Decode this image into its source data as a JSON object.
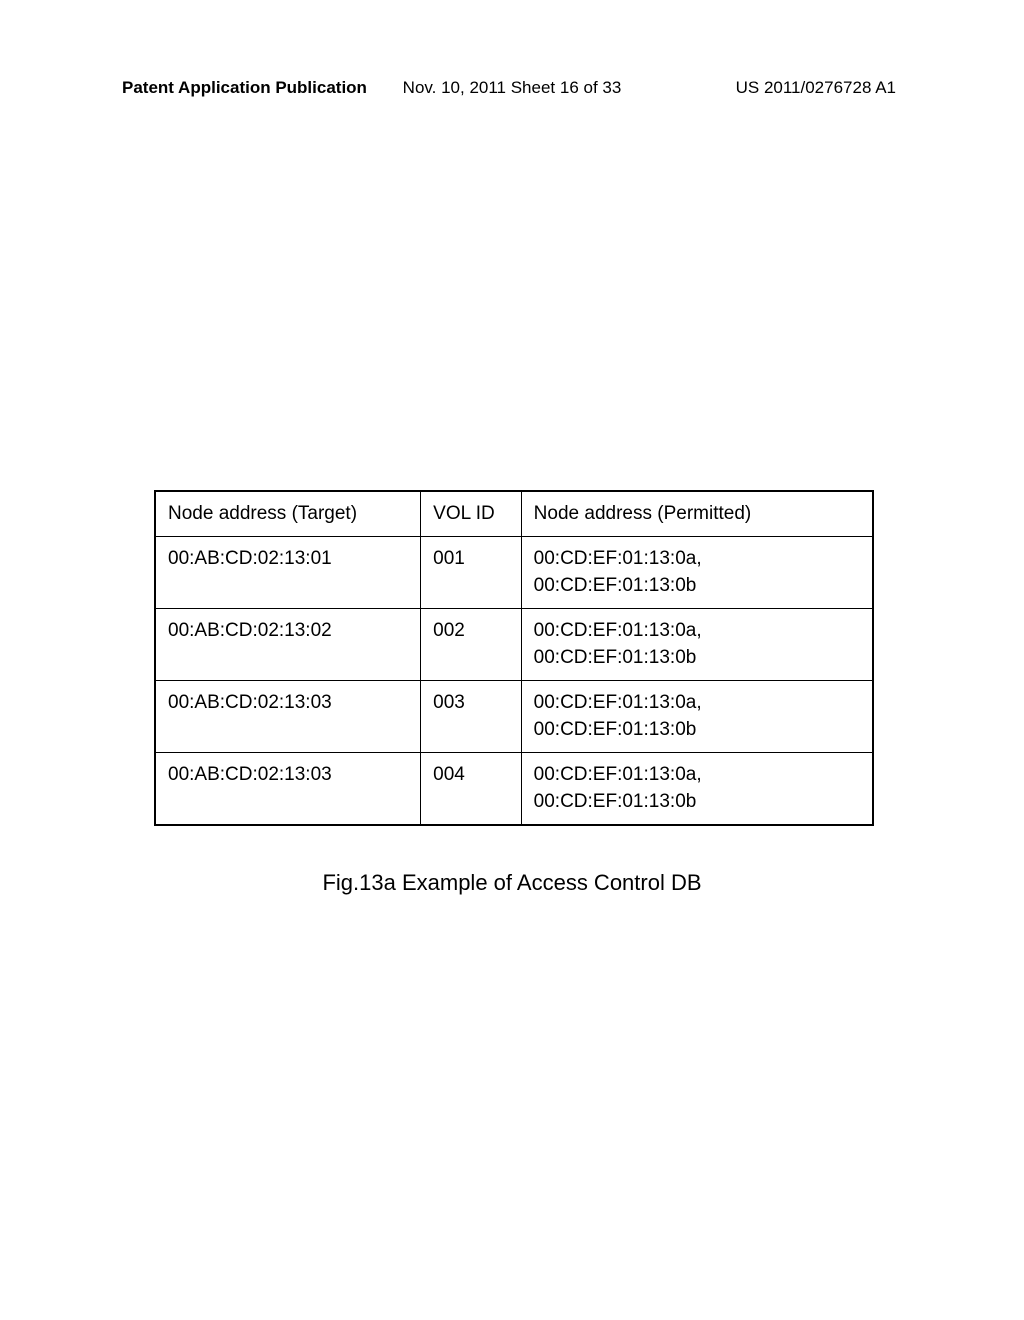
{
  "header": {
    "left": "Patent Application Publication",
    "center": "Nov. 10, 2011  Sheet 16 of 33",
    "right": "US 2011/0276728 A1"
  },
  "table": {
    "headers": {
      "target": "Node address (Target)",
      "vol": "VOL ID",
      "permitted": "Node address (Permitted)"
    },
    "rows": [
      {
        "target": "00:AB:CD:02:13:01",
        "vol": "001",
        "permitted_a": "00:CD:EF:01:13:0a,",
        "permitted_b": "00:CD:EF:01:13:0b"
      },
      {
        "target": "00:AB:CD:02:13:02",
        "vol": "002",
        "permitted_a": "00:CD:EF:01:13:0a,",
        "permitted_b": "00:CD:EF:01:13:0b"
      },
      {
        "target": "00:AB:CD:02:13:03",
        "vol": "003",
        "permitted_a": "00:CD:EF:01:13:0a,",
        "permitted_b": "00:CD:EF:01:13:0b"
      },
      {
        "target": "00:AB:CD:02:13:03",
        "vol": "004",
        "permitted_a": "00:CD:EF:01:13:0a,",
        "permitted_b": "00:CD:EF:01:13:0b"
      }
    ]
  },
  "caption": "Fig.13a Example of Access Control DB"
}
